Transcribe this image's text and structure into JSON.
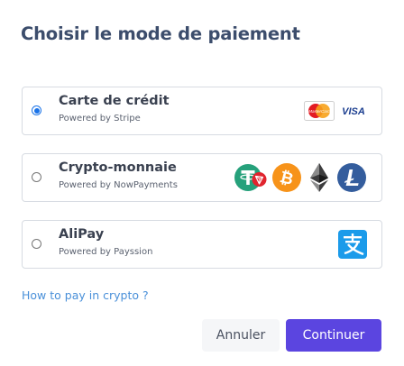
{
  "title": "Choisir le mode de paiement",
  "options": [
    {
      "name": "Carte de crédit",
      "provider": "Powered by Stripe",
      "selected": true,
      "icons": [
        "mastercard-icon",
        "visa-icon"
      ]
    },
    {
      "name": "Crypto-monnaie",
      "provider": "Powered by NowPayments",
      "selected": false,
      "icons": [
        "tether-tron-icon",
        "bitcoin-icon",
        "ethereum-icon",
        "litecoin-icon"
      ]
    },
    {
      "name": "AliPay",
      "provider": "Powered by Payssion",
      "selected": false,
      "icons": [
        "alipay-icon"
      ]
    }
  ],
  "logo_text": {
    "mastercard": "MasterCard",
    "visa": "VISA"
  },
  "help_link": "How to pay in crypto ?",
  "buttons": {
    "cancel": "Annuler",
    "continue": "Continuer"
  },
  "colors": {
    "title": "#3c4d6c",
    "accent": "#5b45e0",
    "link": "#4a90d9",
    "radio_selected": "#1a73e8"
  }
}
